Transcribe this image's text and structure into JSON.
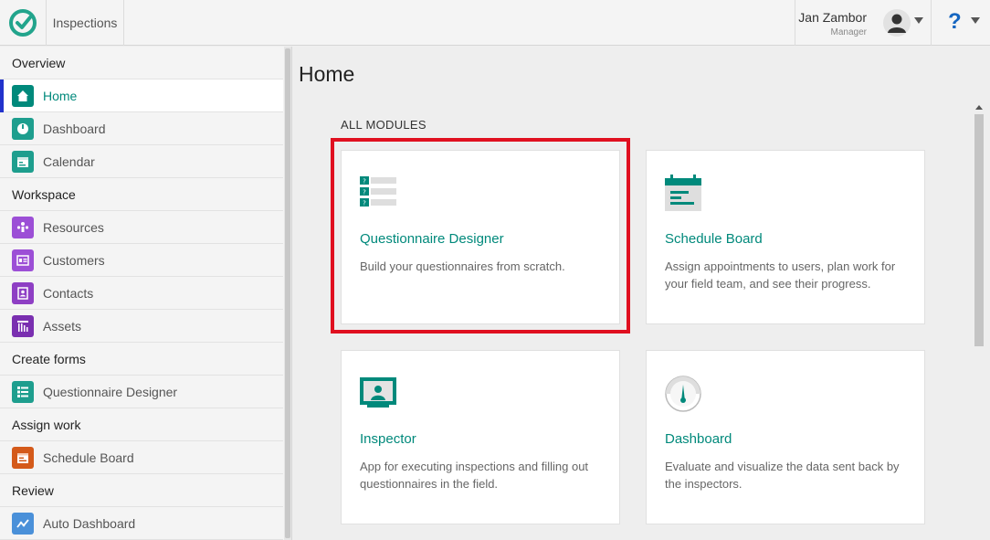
{
  "header": {
    "app_title": "Inspections",
    "user_name": "Jan Zambor",
    "user_role": "Manager",
    "help_label": "?"
  },
  "sidebar": {
    "sections": [
      {
        "label": "Overview",
        "items": [
          {
            "label": "Home",
            "icon": "home-icon",
            "color": "#00897b",
            "active": true
          },
          {
            "label": "Dashboard",
            "icon": "dashboard-icon",
            "color": "#1e9e8e"
          },
          {
            "label": "Calendar",
            "icon": "calendar-icon",
            "color": "#1e9e8e"
          }
        ]
      },
      {
        "label": "Workspace",
        "items": [
          {
            "label": "Resources",
            "icon": "resources-icon",
            "color": "#9c4fd6"
          },
          {
            "label": "Customers",
            "icon": "customers-icon",
            "color": "#9c4fd6"
          },
          {
            "label": "Contacts",
            "icon": "contacts-icon",
            "color": "#8e3fc4"
          },
          {
            "label": "Assets",
            "icon": "assets-icon",
            "color": "#7a2fb0"
          }
        ]
      },
      {
        "label": "Create forms",
        "items": [
          {
            "label": "Questionnaire Designer",
            "icon": "questionnaire-icon",
            "color": "#1e9e8e"
          }
        ]
      },
      {
        "label": "Assign work",
        "items": [
          {
            "label": "Schedule Board",
            "icon": "schedule-icon",
            "color": "#d45a1a"
          }
        ]
      },
      {
        "label": "Review",
        "items": [
          {
            "label": "Auto Dashboard",
            "icon": "auto-dashboard-icon",
            "color": "#4a90d9"
          }
        ]
      }
    ]
  },
  "main": {
    "page_title": "Home",
    "modules_heading": "ALL MODULES",
    "cards": [
      {
        "title": "Questionnaire Designer",
        "description": "Build your questionnaires from scratch.",
        "icon": "questionnaire-icon",
        "highlighted": true
      },
      {
        "title": "Schedule Board",
        "description": "Assign appointments to users, plan work for your field team, and see their progress.",
        "icon": "schedule-board-icon"
      },
      {
        "title": "Inspector",
        "description": "App for executing inspections and filling out questionnaires in the field.",
        "icon": "inspector-icon"
      },
      {
        "title": "Dashboard",
        "description": "Evaluate and visualize the data sent back by the inspectors.",
        "icon": "gauge-icon"
      }
    ]
  },
  "colors": {
    "accent": "#00897b",
    "active_indicator": "#2233cc",
    "highlight": "#e01020",
    "help": "#1565c0"
  }
}
